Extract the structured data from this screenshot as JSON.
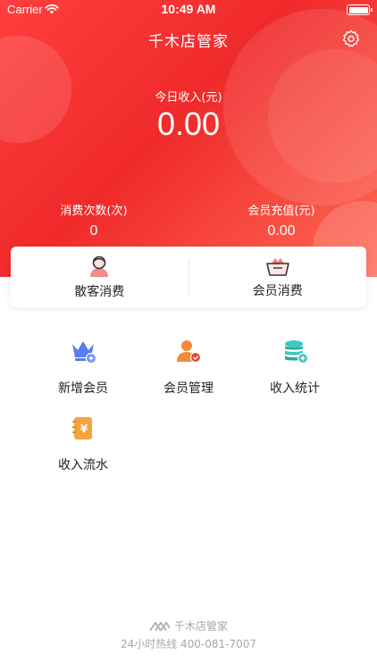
{
  "status_bar": {
    "carrier": "Carrier",
    "time": "10:49 AM"
  },
  "header": {
    "title": "千木店管家",
    "settings_icon": "gear-icon"
  },
  "income": {
    "label": "今日收入(元)",
    "value": "0.00"
  },
  "stats": {
    "count_label": "消费次数(次)",
    "count_value": "0",
    "recharge_label": "会员充值(元)",
    "recharge_value": "0.00"
  },
  "consume": {
    "walkin_label": "散客消费",
    "walkin_icon": "person-icon",
    "member_label": "会员消费",
    "member_icon": "basket-icon"
  },
  "menu": {
    "items": [
      {
        "label": "新增会员",
        "icon": "crown-add-icon"
      },
      {
        "label": "会员管理",
        "icon": "member-manage-icon"
      },
      {
        "label": "收入统计",
        "icon": "coins-stack-icon"
      },
      {
        "label": "收入流水",
        "icon": "yuan-ledger-icon"
      }
    ]
  },
  "footer": {
    "brand": "千木店管家",
    "hotline": "24小时热线 400-081-7007"
  },
  "colors": {
    "primary_red": "#f52f2f",
    "blue": "#5b7bf0",
    "orange": "#f58a3c",
    "teal": "#3fc7c0"
  }
}
